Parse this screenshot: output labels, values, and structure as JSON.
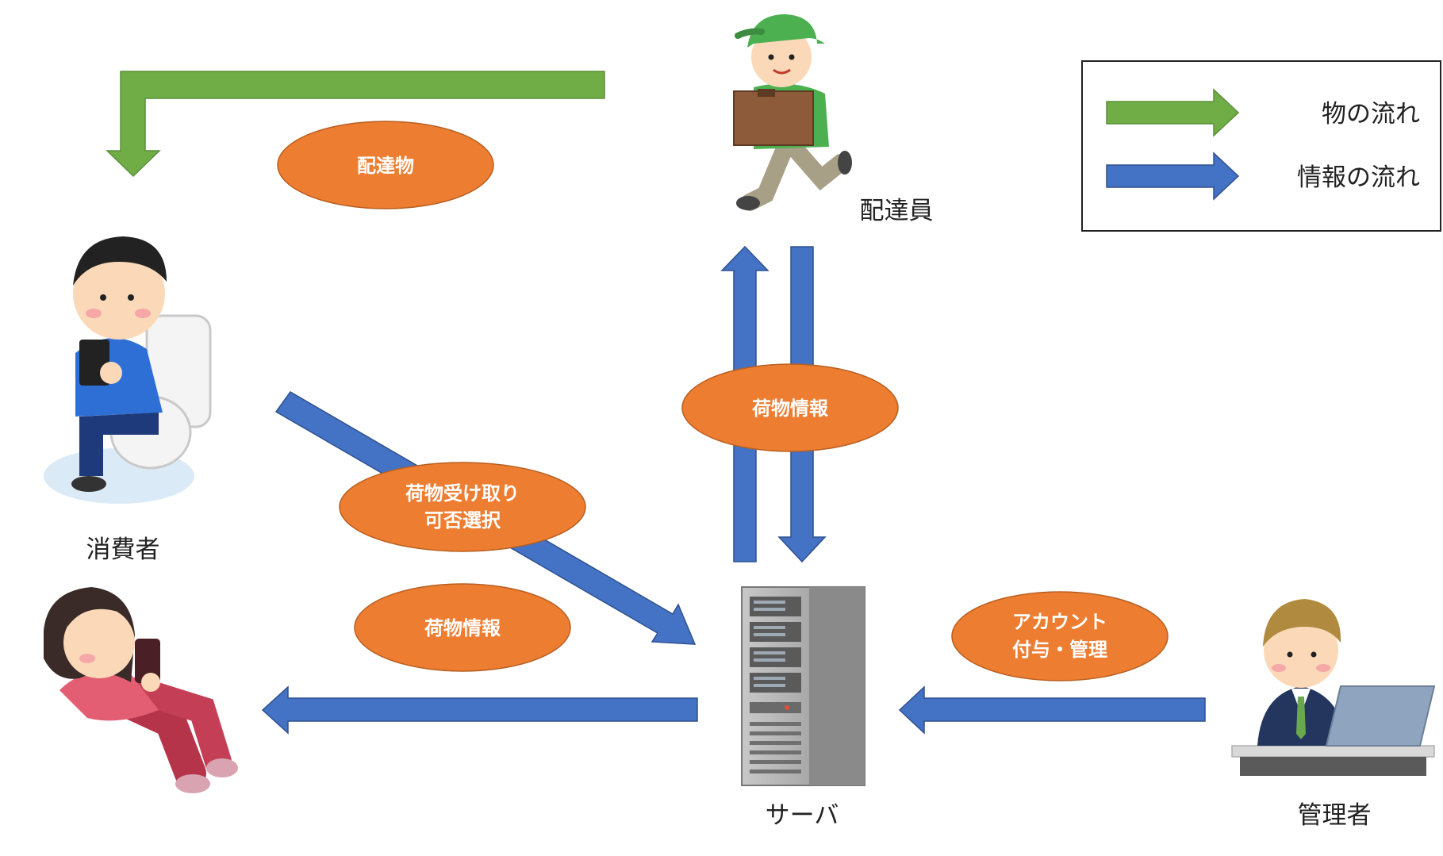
{
  "actors": {
    "delivery_person": {
      "label": "配達員",
      "icon": "delivery-person-icon"
    },
    "consumer": {
      "label": "消費者",
      "icon": "consumer-sitting-icon"
    },
    "consumer_2": {
      "icon": "consumer-lying-icon"
    },
    "server": {
      "label": "サーバ",
      "icon": "server-tower-icon"
    },
    "admin": {
      "label": "管理者",
      "icon": "admin-laptop-icon"
    }
  },
  "flows": {
    "delivery_item": {
      "label_lines": [
        "配達物"
      ]
    },
    "package_info_top": {
      "label_lines": [
        "荷物情報"
      ]
    },
    "receive_choice": {
      "label_lines": [
        "荷物受け取り",
        "可否選択"
      ]
    },
    "package_info_left": {
      "label_lines": [
        "荷物情報"
      ]
    },
    "account": {
      "label_lines": [
        "アカウント",
        "付与・管理"
      ]
    }
  },
  "legend": {
    "items": [
      {
        "label": "物の流れ",
        "color": "#70ad47"
      },
      {
        "label": "情報の流れ",
        "color": "#4472c4"
      }
    ]
  },
  "colors": {
    "goods_arrow": "#70ad47",
    "info_arrow": "#4472c4",
    "ellipse": "#ed7d31"
  }
}
